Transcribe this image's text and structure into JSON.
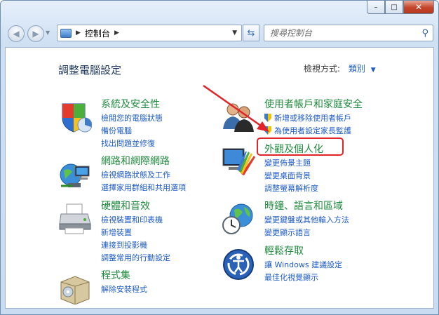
{
  "window": {
    "caption": {
      "minimize": "–",
      "maximize": "□",
      "close": "✕"
    }
  },
  "nav": {
    "back_icon": "back-arrow-icon",
    "forward_icon": "forward-arrow-icon",
    "breadcrumb": "控制台",
    "search_placeholder": "搜尋控制台"
  },
  "content": {
    "title": "調整電腦設定",
    "view_by_label": "檢視方式:",
    "view_by_value": "類別",
    "categories": [
      {
        "id": "system-security",
        "icon": "shield-security-icon",
        "heading": "系統及安全性",
        "links": [
          "檢閱您的電腦狀態",
          "備份電腦",
          "找出問題並修復"
        ]
      },
      {
        "id": "network",
        "icon": "network-globe-icon",
        "heading": "網路和網際網路",
        "links": [
          "檢視網路狀態及工作",
          "選擇家用群組和共用選項"
        ]
      },
      {
        "id": "hardware-sound",
        "icon": "printer-icon",
        "heading": "硬體和音效",
        "links": [
          "檢視裝置和印表機",
          "新增裝置",
          "連接到投影機",
          "調整常用的行動設定"
        ]
      },
      {
        "id": "programs",
        "icon": "programs-box-icon",
        "heading": "程式集",
        "links": [
          "解除安裝程式"
        ]
      },
      {
        "id": "user-accounts",
        "icon": "users-icon",
        "heading": "使用者帳戶和家庭安全",
        "links": [
          "新增或移除使用者帳戶",
          "為使用者設定家長監護"
        ]
      },
      {
        "id": "appearance",
        "icon": "appearance-monitor-icon",
        "heading": "外觀及個人化",
        "links": [
          "變更佈景主題",
          "變更桌面背景",
          "調整螢幕解析度"
        ]
      },
      {
        "id": "clock-region",
        "icon": "clock-globe-icon",
        "heading": "時鐘、語言和區域",
        "links": [
          "變更鍵盤或其他輸入方法",
          "變更顯示語言"
        ]
      },
      {
        "id": "ease-of-access",
        "icon": "ease-of-access-icon",
        "heading": "輕鬆存取",
        "links": [
          "讓 Windows 建議設定",
          "最佳化視覺顯示"
        ]
      }
    ]
  }
}
